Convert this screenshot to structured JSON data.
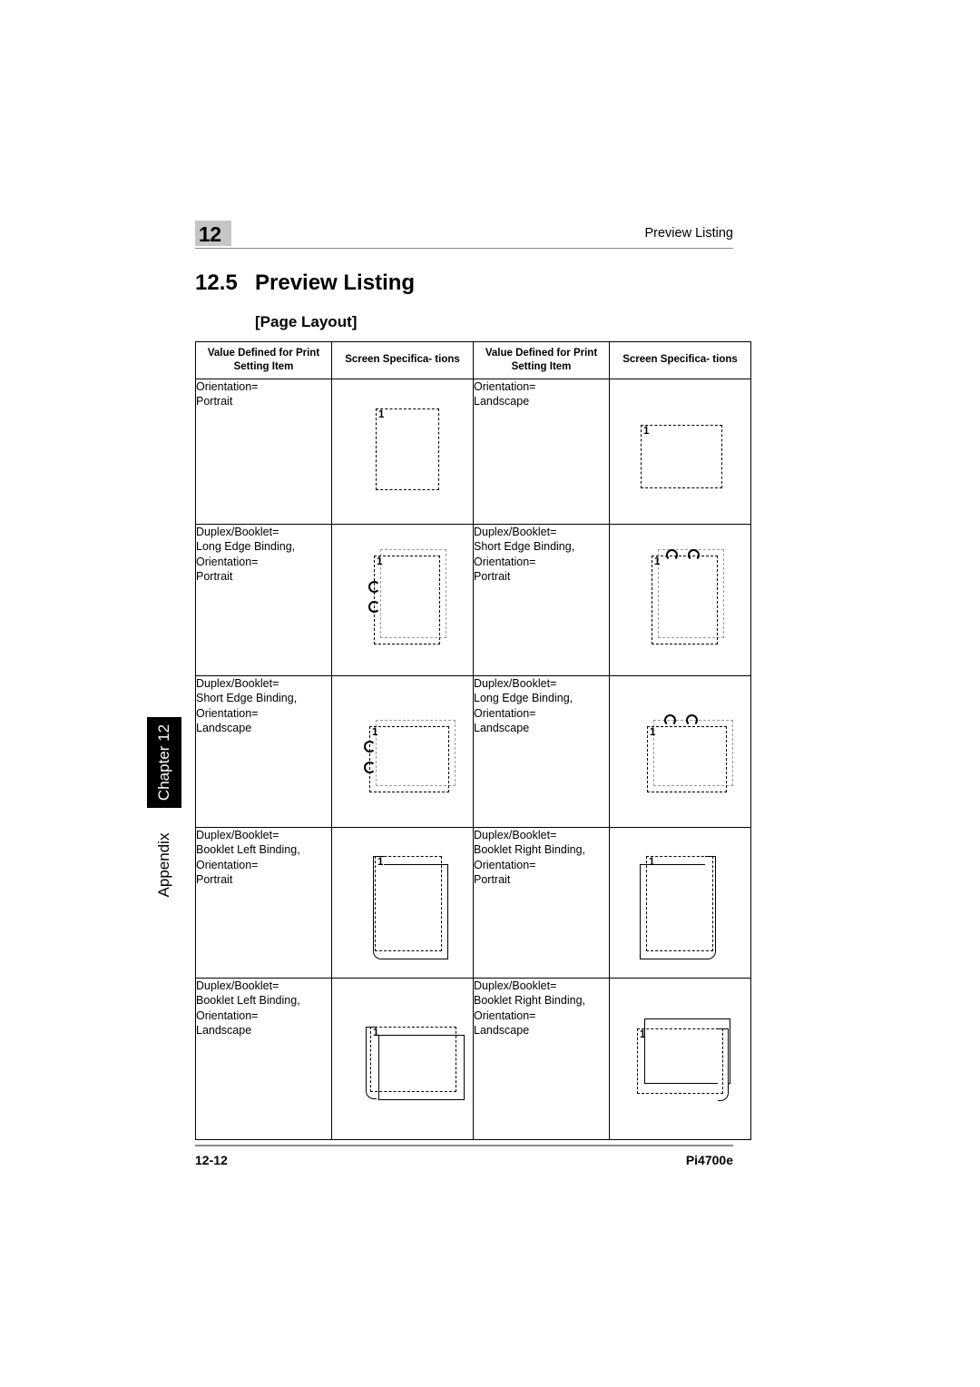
{
  "header": {
    "chapter_number": "12",
    "running_title": "Preview Listing"
  },
  "title": {
    "section_number": "12.5",
    "section_name": "Preview Listing",
    "subsection": "[Page Layout]"
  },
  "side_tab": {
    "chapter_label": "Chapter 12",
    "appendix_label": "Appendix"
  },
  "table": {
    "headers": [
      "Value Defined for\nPrint Setting Item",
      "Screen Specifica-\ntions",
      "Value Defined for\nPrint Setting Item",
      "Screen Specifica-\ntions"
    ],
    "rows": [
      {
        "left_setting": "Orientation=\nPortrait",
        "left_figure": "single-portrait-page",
        "right_setting": "Orientation=\nLandscape",
        "right_figure": "single-landscape-page"
      },
      {
        "left_setting": "Duplex/Booklet=\nLong Edge Binding,\nOrientation=\nPortrait",
        "left_figure": "portrait-long-edge-binding",
        "right_setting": "Duplex/Booklet=\nShort Edge Binding,\nOrientation=\nPortrait",
        "right_figure": "portrait-short-edge-binding"
      },
      {
        "left_setting": "Duplex/Booklet=\nShort Edge Binding,\nOrientation=\nLandscape",
        "left_figure": "landscape-short-edge-binding",
        "right_setting": "Duplex/Booklet=\nLong Edge Binding,\nOrientation=\nLandscape",
        "right_figure": "landscape-long-edge-binding"
      },
      {
        "left_setting": "Duplex/Booklet=\nBooklet Left Binding,\nOrientation=\nPortrait",
        "left_figure": "portrait-booklet-left",
        "right_setting": "Duplex/Booklet=\nBooklet Right Binding,\nOrientation=\nPortrait",
        "right_figure": "portrait-booklet-right"
      },
      {
        "left_setting": "Duplex/Booklet=\nBooklet Left Binding,\nOrientation=\nLandscape",
        "left_figure": "landscape-booklet-left",
        "right_setting": "Duplex/Booklet=\nBooklet Right Binding,\nOrientation=\nLandscape",
        "right_figure": "landscape-booklet-right"
      }
    ],
    "page_marker": "1"
  },
  "footer": {
    "page_number": "12-12",
    "product_code": "Pi4700e"
  }
}
